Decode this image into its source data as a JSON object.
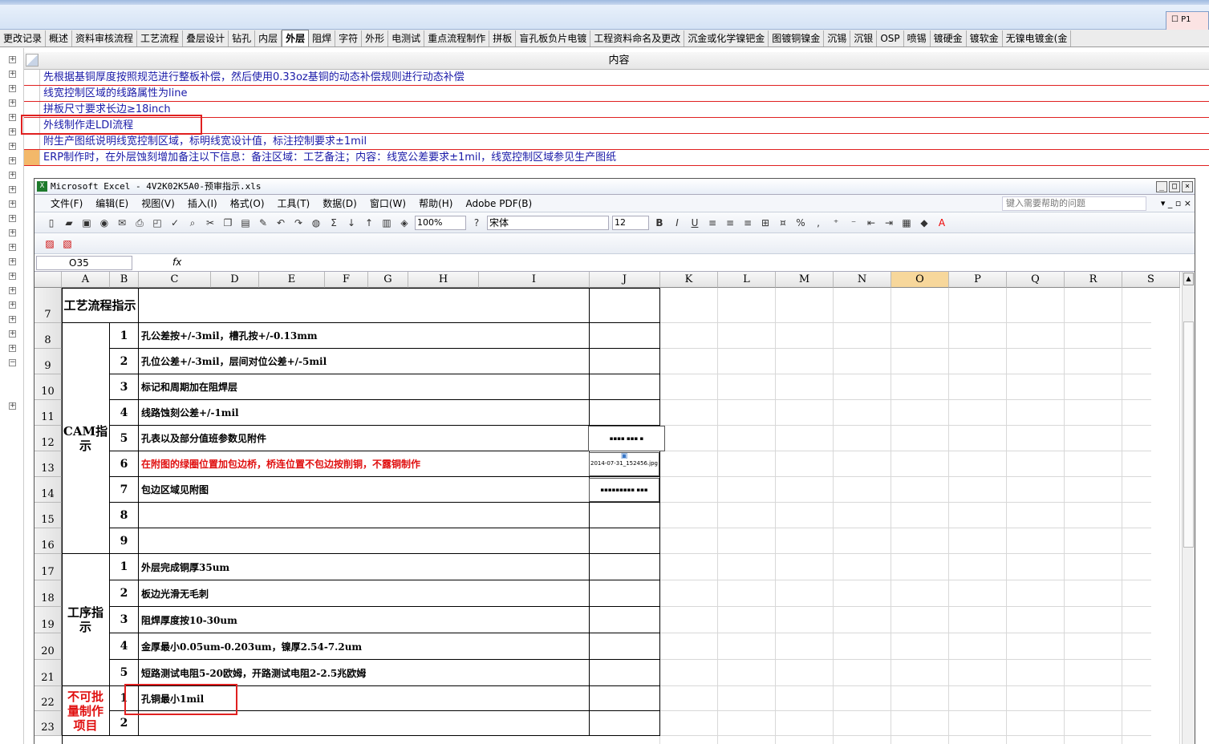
{
  "app": {
    "f1_label": "P1"
  },
  "tabs": [
    "更改记录",
    "概述",
    "资料审核流程",
    "工艺流程",
    "叠层设计",
    "钻孔",
    "内层",
    "外层",
    "阻焊",
    "字符",
    "外形",
    "电测试",
    "重点流程制作",
    "拼板",
    "盲孔板负片电镀",
    "工程资料命名及更改",
    "沉金或化学镍钯金",
    "图镀铜镍金",
    "沉锡",
    "沉银",
    "OSP",
    "喷锡",
    "镀硬金",
    "镀软金",
    "无镍电镀金(金"
  ],
  "active_tab": "外层",
  "grid": {
    "header": "内容",
    "rows": [
      "先根据基铜厚度按照规范进行整板补偿，然后使用0.33oz基铜的动态补偿规则进行动态补偿",
      "线宽控制区域的线路属性为line",
      "拼板尺寸要求长边≥18inch",
      "外线制作走LDI流程",
      "附生产图纸说明线宽控制区域，标明线宽设计值，标注控制要求±1mil",
      "ERP制作时，在外层蚀刻增加备注以下信息：备注区域：工艺备注；内容：线宽公差要求±1mil，线宽控制区域参见生产图纸"
    ]
  },
  "excel": {
    "title": "Microsoft Excel - 4V2K02K5A0-预审指示.xls",
    "menu": [
      "文件(F)",
      "编辑(E)",
      "视图(V)",
      "插入(I)",
      "格式(O)",
      "工具(T)",
      "数据(D)",
      "窗口(W)",
      "帮助(H)",
      "Adobe PDF(B)"
    ],
    "help_placeholder": "键入需要帮助的问题",
    "zoom": "100%",
    "font": "宋体",
    "font_size": "12",
    "name_box": "O35",
    "fx": "fx",
    "columns": [
      "A",
      "B",
      "C",
      "D",
      "E",
      "F",
      "G",
      "H",
      "I",
      "J",
      "K",
      "L",
      "M",
      "N",
      "O",
      "P",
      "Q",
      "R",
      "S"
    ],
    "selected_column": "O",
    "row_numbers": [
      "7",
      "8",
      "9",
      "10",
      "11",
      "12",
      "13",
      "14",
      "15",
      "16",
      "17",
      "18",
      "19",
      "20",
      "21",
      "22",
      "23"
    ],
    "section_labels": {
      "process": "工艺流程指示",
      "cam": "CAM指示",
      "procedure": "工序指示",
      "nobatch": "不可批量制作项目"
    },
    "cam_items": [
      {
        "no": "1",
        "text": "孔公差按+/-3mil，槽孔按+/-0.13mm"
      },
      {
        "no": "2",
        "text": "孔位公差+/-3mil，层间对位公差+/-5mil"
      },
      {
        "no": "3",
        "text": "标记和周期加在阻焊层"
      },
      {
        "no": "4",
        "text": "线路蚀刻公差+/-1mil"
      },
      {
        "no": "5",
        "text": "孔表以及部分值班参数见附件"
      },
      {
        "no": "6",
        "text": "在附图的绿圈位置加包边桥，桥连位置不包边按削铜，不露铜制作"
      },
      {
        "no": "7",
        "text": "包边区域见附图"
      },
      {
        "no": "8",
        "text": ""
      },
      {
        "no": "9",
        "text": ""
      }
    ],
    "procedure_items": [
      {
        "no": "1",
        "text": "外层完成铜厚35um"
      },
      {
        "no": "2",
        "text": "板边光滑无毛刺"
      },
      {
        "no": "3",
        "text": "阻焊厚度按10-30um"
      },
      {
        "no": "4",
        "text": "金厚最小0.05um-0.203um，镍厚2.54-7.2um"
      },
      {
        "no": "5",
        "text": "短路测试电阻5-20欧姆，开路测试电阻2-2.5兆欧姆"
      }
    ],
    "nobatch_items": [
      {
        "no": "1",
        "text": "孔铜最小1mil"
      },
      {
        "no": "2",
        "text": ""
      }
    ],
    "attachments": [
      "2014-07-31_152456.jpg"
    ]
  }
}
